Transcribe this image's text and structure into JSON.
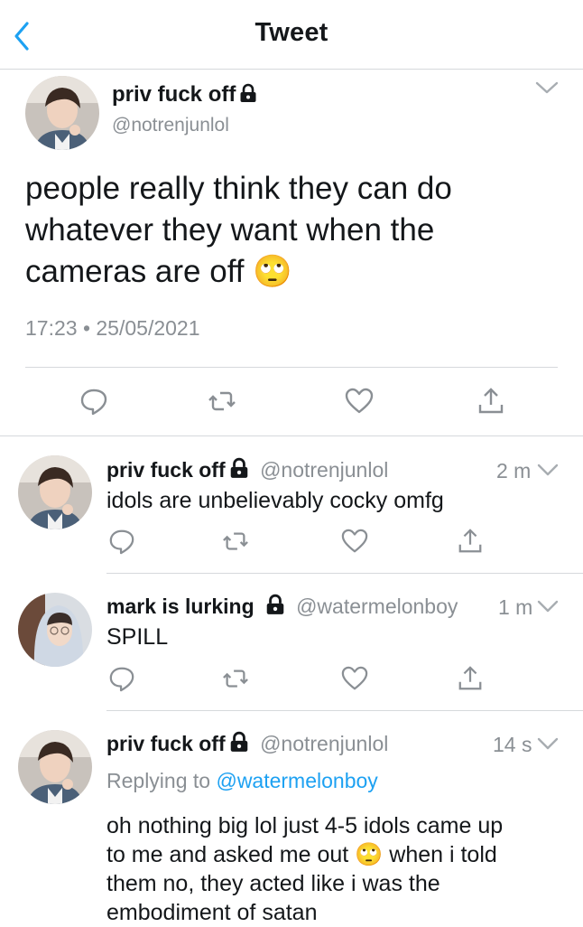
{
  "header": {
    "title": "Tweet"
  },
  "main_tweet": {
    "display_name": "priv fuck off",
    "handle": "@notrenjunlol",
    "text": "people really think they can do whatever they want when the cameras are off",
    "emoji": "🙄",
    "timestamp": "17:23 • 25/05/2021"
  },
  "replies": [
    {
      "display_name": "priv fuck off",
      "handle": "@notrenjunlol",
      "time": "2 m",
      "text": "idols are unbelievably cocky omfg"
    },
    {
      "display_name": "mark is lurking",
      "handle": "@watermelonboy",
      "time": "1 m",
      "text": "SPILL"
    },
    {
      "display_name": "priv fuck off",
      "handle": "@notrenjunlol",
      "time": "14 s",
      "replying_prefix": "Replying to ",
      "replying_to": "@watermelonboy",
      "text_line1": "oh nothing big lol just 4-5 idols came up",
      "text_line2a": "to me and asked me out",
      "emoji": "🙄",
      "text_line2b": "when i told",
      "text_line3": "them no, they acted like i was the",
      "text_line4": "embodiment of satan"
    }
  ],
  "icons": {
    "back": "chevron-left-icon",
    "lock": "lock-icon",
    "reply": "reply-icon",
    "retweet": "retweet-icon",
    "like": "heart-icon",
    "share": "share-icon",
    "more": "chevron-down-icon"
  },
  "colors": {
    "accent": "#1da1f2",
    "secondary_text": "#8a8f94",
    "divider": "#d6d9dc"
  }
}
